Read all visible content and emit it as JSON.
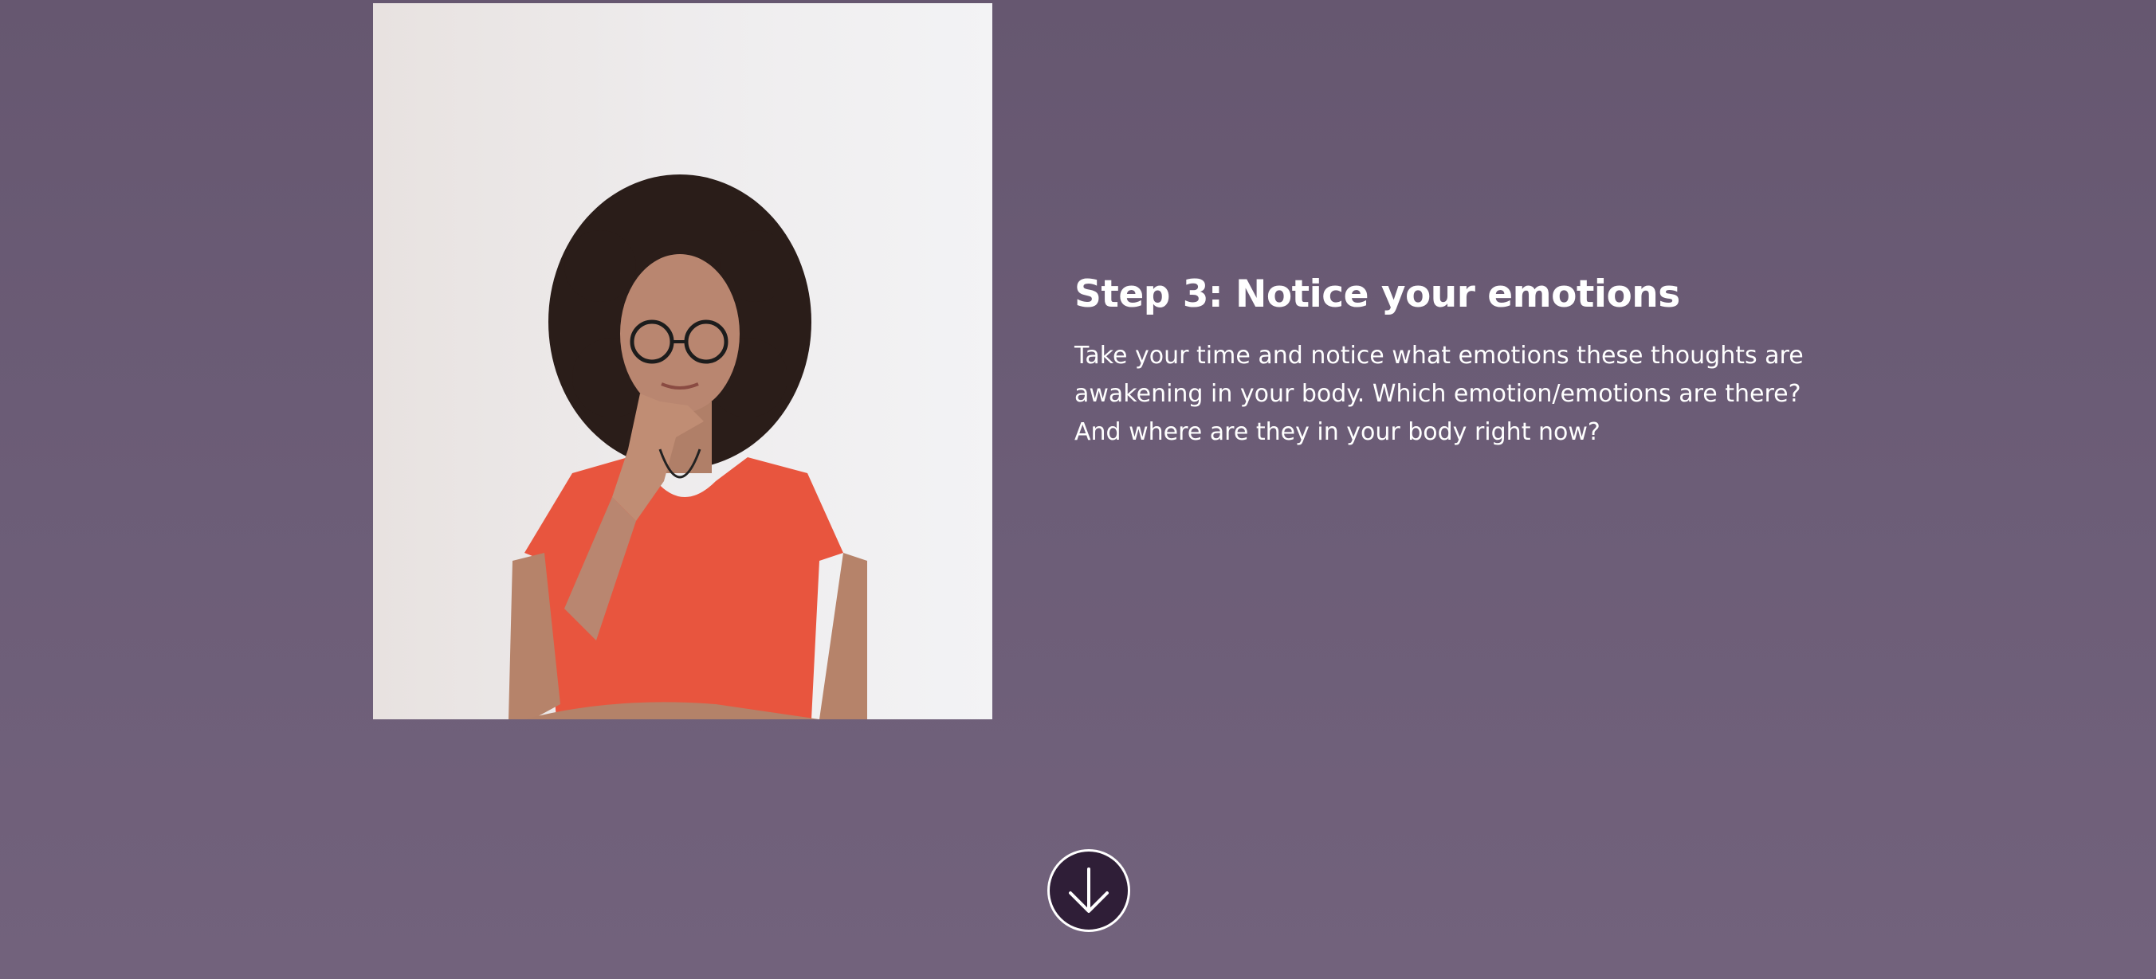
{
  "section": {
    "photo": {
      "icon": "person-thinking-photo"
    },
    "heading": "Step 3: Notice your emotions",
    "body": "Take your time and notice what emotions these thoughts are awakening in your body. Which emotion/emotions are there? And where are they in your body right now?"
  },
  "scroll_button": {
    "icon": "arrow-down-icon"
  },
  "colors": {
    "background": "#6b5c75",
    "button_fill": "#2f1e37",
    "shirt": "#e8553e",
    "text": "#ffffff"
  }
}
